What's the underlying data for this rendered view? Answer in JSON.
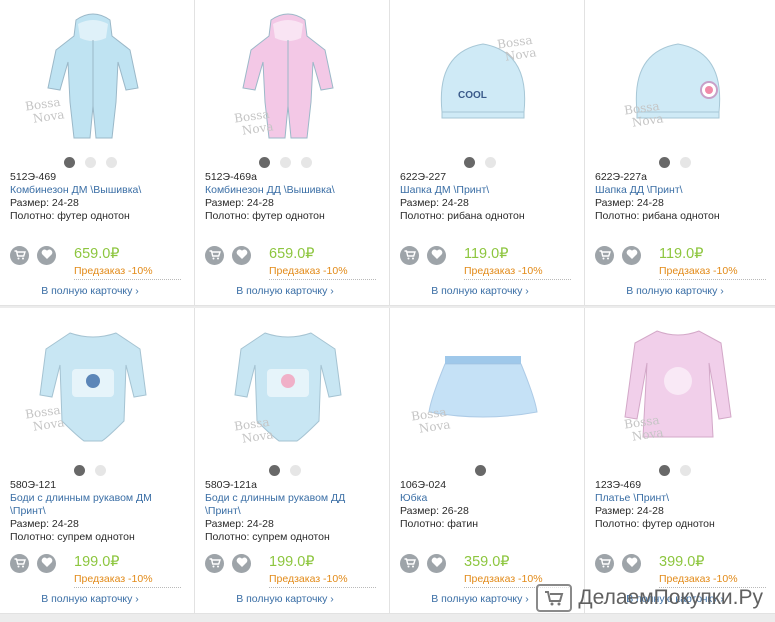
{
  "watermark": "ДелаемПокупки.Ру",
  "brand_watermark": [
    "Bossa",
    "Nova"
  ],
  "cards": [
    {
      "code": "512Э-469",
      "title": "Комбинезон ДМ \\Вышивка\\",
      "size": "Размер: 24-28",
      "fabric": "Полотно: футер однотон",
      "price": "659.0₽",
      "preorder": "Предзаказ -10%",
      "more": "В полную карточку ›",
      "dots": 3,
      "color": "#bfe3f2"
    },
    {
      "code": "512Э-469а",
      "title": "Комбинезон ДД \\Вышивка\\",
      "size": "Размер: 24-28",
      "fabric": "Полотно: футер однотон",
      "price": "659.0₽",
      "preorder": "Предзаказ -10%",
      "more": "В полную карточку ›",
      "dots": 3,
      "color": "#f3c8e6"
    },
    {
      "code": "622Э-227",
      "title": "Шапка ДМ \\Принт\\",
      "size": "Размер: 24-28",
      "fabric": "Полотно: рибана однотон",
      "price": "119.0₽",
      "preorder": "Предзаказ -10%",
      "more": "В полную карточку ›",
      "dots": 2,
      "color": "#cfeaf6",
      "print": "COOL"
    },
    {
      "code": "622Э-227а",
      "title": "Шапка ДД \\Принт\\",
      "size": "Размер: 24-28",
      "fabric": "Полотно: рибана однотон",
      "price": "119.0₽",
      "preorder": "Предзаказ -10%",
      "more": "В полную карточку ›",
      "dots": 2,
      "color": "#cfeaf6"
    },
    {
      "code": "580Э-121",
      "title": "Боди с длинным рукавом ДМ \\Принт\\",
      "size": "Размер: 24-28",
      "fabric": "Полотно: супрем однотон",
      "price": "199.0₽",
      "preorder": "Предзаказ -10%",
      "more": "В полную карточку ›",
      "dots": 2,
      "color": "#c8e6f3"
    },
    {
      "code": "580Э-121а",
      "title": "Боди с длинным рукавом ДД \\Принт\\",
      "size": "Размер: 24-28",
      "fabric": "Полотно: супрем однотон",
      "price": "199.0₽",
      "preorder": "Предзаказ -10%",
      "more": "В полную карточку ›",
      "dots": 2,
      "color": "#c8e6f3"
    },
    {
      "code": "106Э-024",
      "title": "Юбка",
      "size": "Размер: 26-28",
      "fabric": "Полотно: фатин",
      "price": "359.0₽",
      "preorder": "Предзаказ -10%",
      "more": "В полную карточку ›",
      "dots": 1,
      "color": "#bcdcf5"
    },
    {
      "code": "123Э-469",
      "title": "Платье \\Принт\\",
      "size": "Размер: 24-28",
      "fabric": "Полотно: футер однотон",
      "price": "399.0₽",
      "preorder": "Предзаказ -10%",
      "more": "В полную карточку ›",
      "dots": 2,
      "color": "#f1cfea"
    }
  ]
}
